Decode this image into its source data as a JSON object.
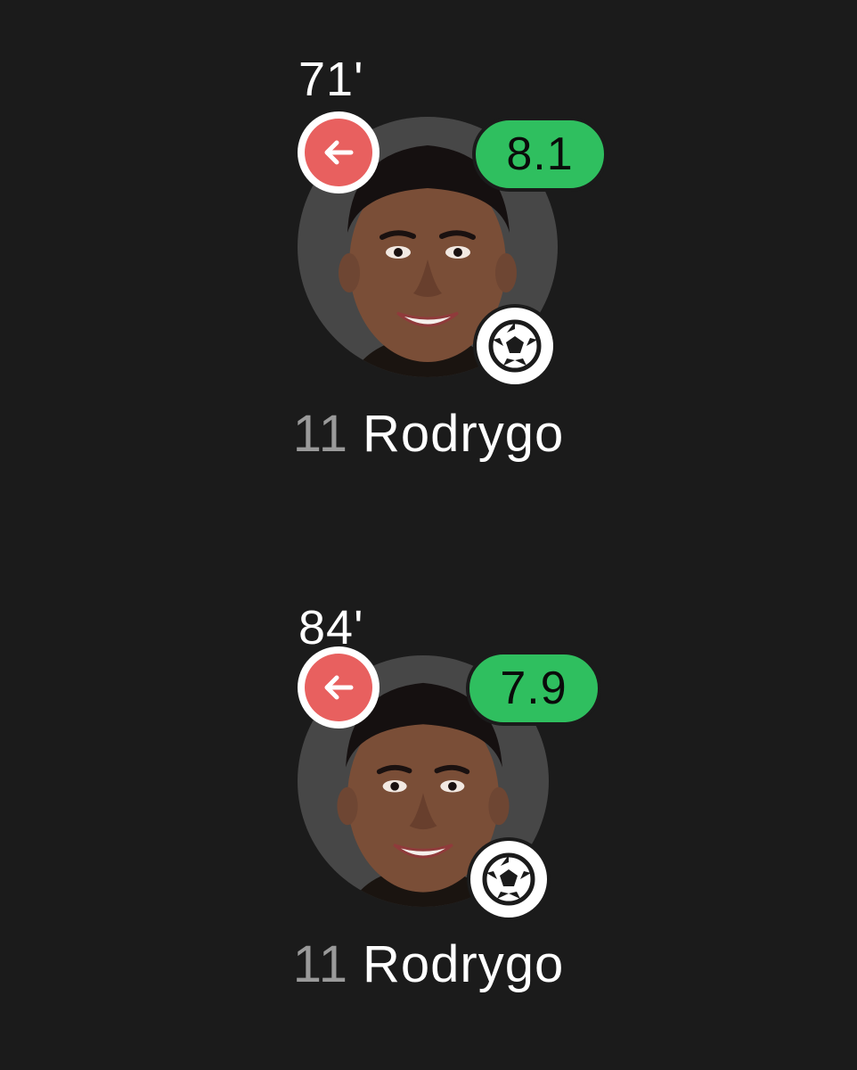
{
  "players": [
    {
      "sub_minute": "71'",
      "rating": "8.1",
      "number": "11",
      "name": "Rodrygo",
      "icons": [
        "substitution-off-icon",
        "goal-ball-icon"
      ],
      "colors": {
        "rating_bg": "#2fbf5f",
        "sub_off_bg": "#e8605f"
      }
    },
    {
      "sub_minute": "84'",
      "rating": "7.9",
      "number": "11",
      "name": "Rodrygo",
      "icons": [
        "substitution-off-icon",
        "goal-ball-icon"
      ],
      "colors": {
        "rating_bg": "#2fbf5f",
        "sub_off_bg": "#e8605f"
      }
    }
  ]
}
